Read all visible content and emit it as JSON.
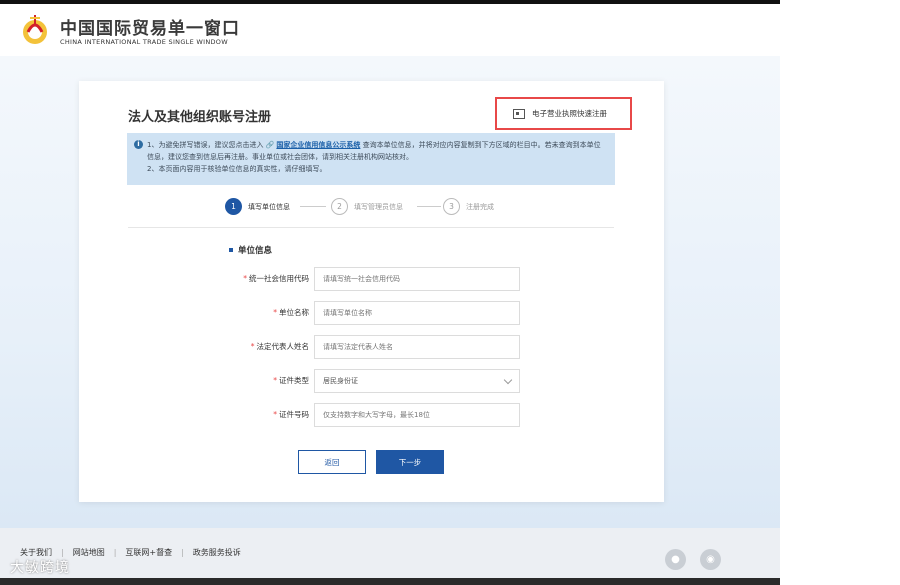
{
  "header": {
    "title": "中国国际贸易单一窗口",
    "subtitle": "CHINA INTERNATIONAL TRADE SINGLE WINDOW"
  },
  "card": {
    "title": "法人及其他组织账号注册",
    "quick_register_label": "电子营业执照快速注册"
  },
  "notice": {
    "line1_prefix": "1、为避免拼写错误，建议您点击进入",
    "link_label": "国家企业信用信息公示系统",
    "line1_suffix": "查询本单位信息，并将对应内容复制到下方区域的栏目中。若未查询到本单位信息，建议您查到信息后再注册。事业单位或社会团体，请到相关注册机构网站核对。",
    "line2": "2、本页面内容用于核验单位信息的真实性，请仔细填写。"
  },
  "steps": [
    {
      "num": "1",
      "label": "填写单位信息"
    },
    {
      "num": "2",
      "label": "填写管理员信息"
    },
    {
      "num": "3",
      "label": "注册完成"
    }
  ],
  "section": {
    "title": "单位信息"
  },
  "form": {
    "credit_code": {
      "label": "统一社会信用代码",
      "placeholder": "请填写统一社会信用代码"
    },
    "org_name": {
      "label": "单位名称",
      "placeholder": "请填写单位名称"
    },
    "legal_rep": {
      "label": "法定代表人姓名",
      "placeholder": "请填写法定代表人姓名"
    },
    "id_type": {
      "label": "证件类型",
      "value": "居民身份证"
    },
    "id_number": {
      "label": "证件号码",
      "placeholder": "仅支持数字和大写字母，最长18位"
    },
    "required_mark": "*"
  },
  "buttons": {
    "back": "返回",
    "next": "下一步"
  },
  "footer": {
    "links": [
      "关于我们",
      "网站地图",
      "互联网+督查",
      "政务服务投诉"
    ]
  },
  "watermark": "大敏跨境",
  "colors": {
    "primary": "#1f57a4",
    "highlight_border": "#e84848",
    "notice_bg": "#cfe2f3"
  }
}
